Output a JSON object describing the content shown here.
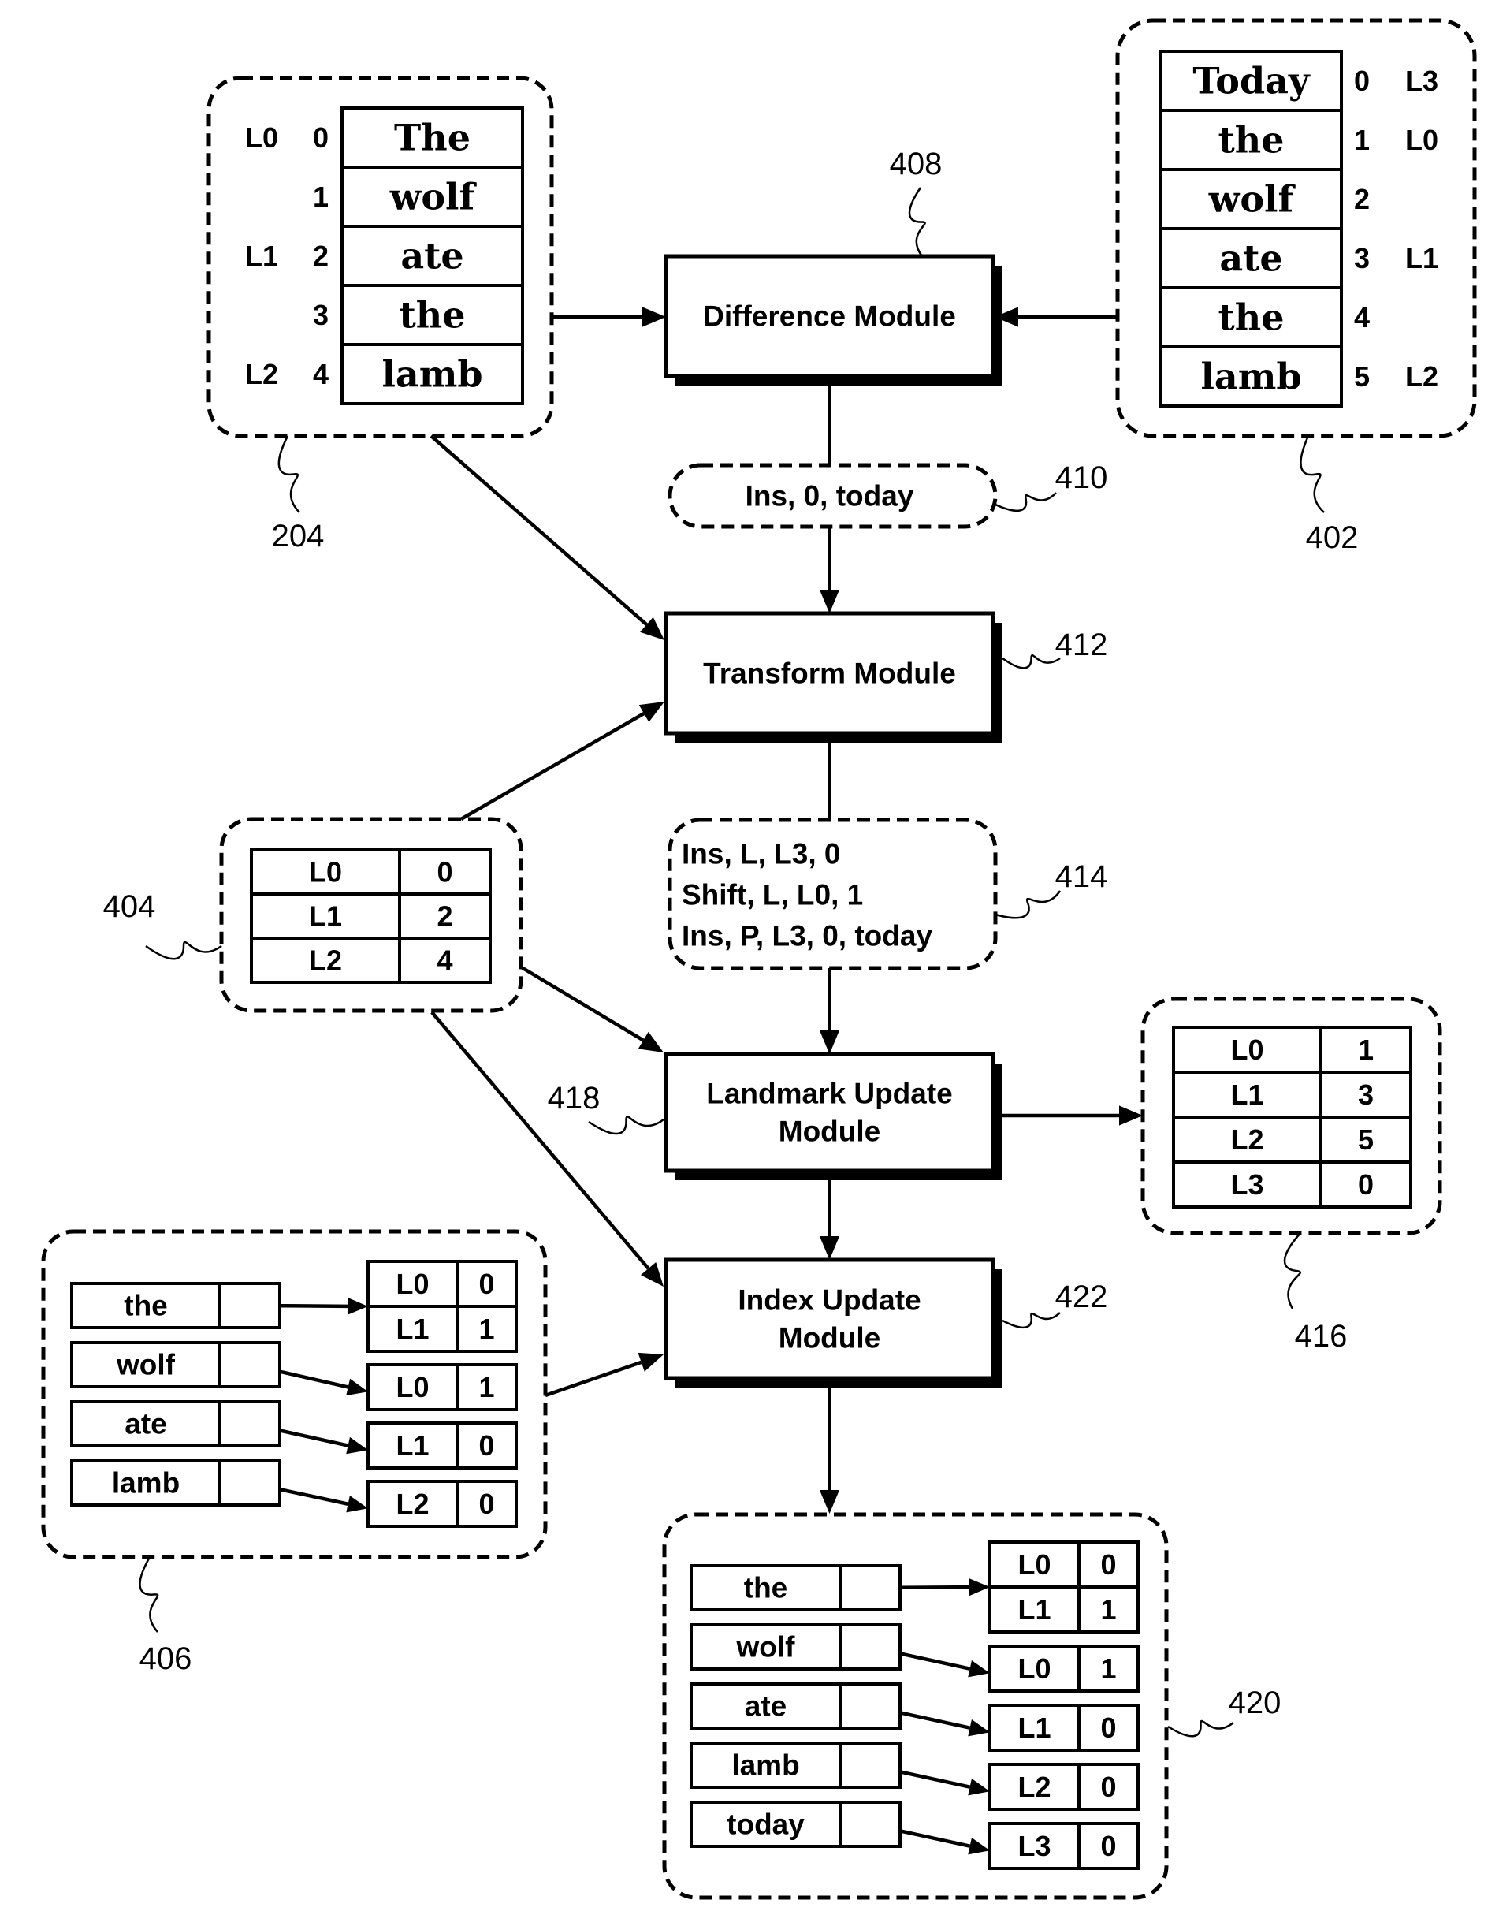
{
  "figure": {
    "modules": {
      "difference": {
        "ref": "408",
        "lines": [
          "Difference Module"
        ]
      },
      "transform": {
        "ref": "412",
        "lines": [
          "Transform Module"
        ]
      },
      "landmark_update": {
        "ref": "418",
        "lines": [
          "Landmark Update",
          "Module"
        ]
      },
      "index_update": {
        "ref": "422",
        "lines": [
          "Index Update",
          "Module"
        ]
      }
    },
    "original_document": {
      "ref": "204",
      "rows": [
        {
          "landmark": "L0",
          "index": "0",
          "word": "The"
        },
        {
          "landmark": "",
          "index": "1",
          "word": "wolf"
        },
        {
          "landmark": "L1",
          "index": "2",
          "word": "ate"
        },
        {
          "landmark": "",
          "index": "3",
          "word": "the"
        },
        {
          "landmark": "L2",
          "index": "4",
          "word": "lamb"
        }
      ]
    },
    "modified_document": {
      "ref": "402",
      "rows": [
        {
          "word": "Today",
          "index": "0",
          "landmark": "L3"
        },
        {
          "word": "the",
          "index": "1",
          "landmark": "L0"
        },
        {
          "word": "wolf",
          "index": "2",
          "landmark": ""
        },
        {
          "word": "ate",
          "index": "3",
          "landmark": "L1"
        },
        {
          "word": "the",
          "index": "4",
          "landmark": ""
        },
        {
          "word": "lamb",
          "index": "5",
          "landmark": "L2"
        }
      ]
    },
    "difference_output": {
      "ref": "410",
      "text": "Ins, 0, today"
    },
    "transform_output": {
      "ref": "414",
      "lines": [
        "Ins, L, L3, 0",
        "Shift, L, L0, 1",
        "Ins, P, L3, 0, today"
      ]
    },
    "landmark_table_before": {
      "ref": "404",
      "rows": [
        [
          "L0",
          "0"
        ],
        [
          "L1",
          "2"
        ],
        [
          "L2",
          "4"
        ]
      ]
    },
    "landmark_table_after": {
      "ref": "416",
      "rows": [
        [
          "L0",
          "1"
        ],
        [
          "L1",
          "3"
        ],
        [
          "L2",
          "5"
        ],
        [
          "L3",
          "0"
        ]
      ]
    },
    "index_before": {
      "ref": "406",
      "entries": [
        {
          "word": "the",
          "postings": [
            [
              "L0",
              "0"
            ],
            [
              "L1",
              "1"
            ]
          ]
        },
        {
          "word": "wolf",
          "postings": [
            [
              "L0",
              "1"
            ]
          ]
        },
        {
          "word": "ate",
          "postings": [
            [
              "L1",
              "0"
            ]
          ]
        },
        {
          "word": "lamb",
          "postings": [
            [
              "L2",
              "0"
            ]
          ]
        }
      ]
    },
    "index_after": {
      "ref": "420",
      "entries": [
        {
          "word": "the",
          "postings": [
            [
              "L0",
              "0"
            ],
            [
              "L1",
              "1"
            ]
          ]
        },
        {
          "word": "wolf",
          "postings": [
            [
              "L0",
              "1"
            ]
          ]
        },
        {
          "word": "ate",
          "postings": [
            [
              "L1",
              "0"
            ]
          ]
        },
        {
          "word": "lamb",
          "postings": [
            [
              "L2",
              "0"
            ]
          ]
        },
        {
          "word": "today",
          "postings": [
            [
              "L3",
              "0"
            ]
          ]
        }
      ]
    }
  }
}
